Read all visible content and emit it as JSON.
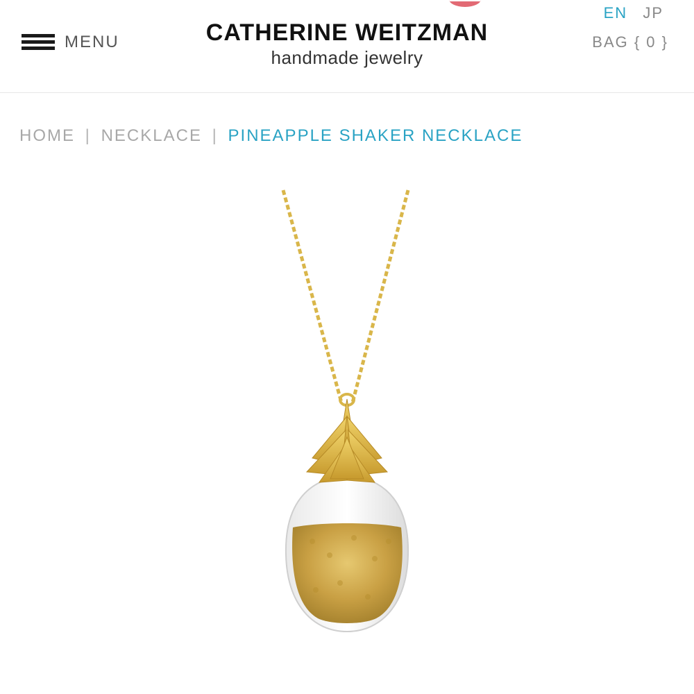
{
  "header": {
    "menu_label": "MENU",
    "brand_name": "CATHERINE WEITZMAN",
    "brand_tagline": "handmade jewelry",
    "languages": [
      {
        "code": "EN",
        "active": true
      },
      {
        "code": "JP",
        "active": false
      }
    ],
    "bag_label": "BAG { 0 }"
  },
  "breadcrumb": {
    "items": [
      "HOME",
      "NECKLACE"
    ],
    "separator": "|",
    "current": "PINEAPPLE SHAKER NECKLACE"
  },
  "colors": {
    "accent": "#2aa3c4",
    "muted": "#a8a8a8",
    "gold": "#d9b64a"
  },
  "product": {
    "image_icon": "pineapple-shaker-necklace-image"
  }
}
